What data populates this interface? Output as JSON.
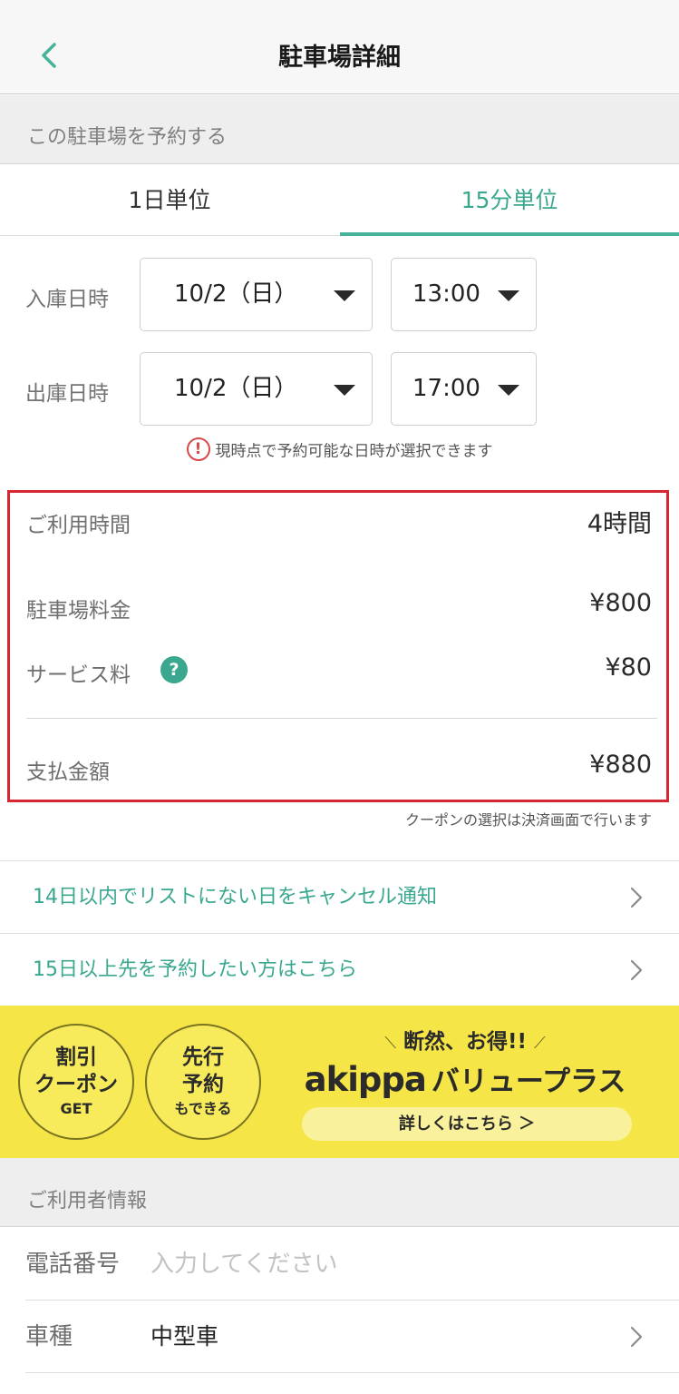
{
  "header": {
    "title": "駐車場詳細",
    "back_icon": "chevron-left-icon"
  },
  "reserve": {
    "section_title": "この駐車場を予約する",
    "tabs": [
      {
        "label": "1日単位"
      },
      {
        "label": "15分単位"
      }
    ],
    "active_tab": "15分単位",
    "entry": {
      "label": "入庫日時",
      "date": "10/2（日）",
      "time": "13:00"
    },
    "exit": {
      "label": "出庫日時",
      "date": "10/2（日）",
      "time": "17:00"
    },
    "notice": {
      "icon_text": "!",
      "text": "現時点で予約可能な日時が選択できます"
    }
  },
  "fees": {
    "usage_time": {
      "label": "ご利用時間",
      "value": "4時間"
    },
    "parking_fee": {
      "label": "駐車場料金",
      "value": "¥800"
    },
    "service_fee": {
      "label": "サービス料",
      "value": "¥80",
      "help_icon_text": "?"
    },
    "total": {
      "label": "支払金額",
      "value": "¥880"
    }
  },
  "coupon_note": "クーポンの選択は決済画面で行います",
  "links": [
    {
      "label": "14日以内でリストにない日をキャンセル通知"
    },
    {
      "label": "15日以上先を予約したい方はこちら"
    }
  ],
  "banner": {
    "circle1": [
      "割引",
      "クーポン",
      "GET"
    ],
    "circle2": [
      "先行",
      "予約",
      "もできる"
    ],
    "deco_left": "⟍",
    "deco_right": "⟋",
    "headline": "断然、お得!!",
    "brand": "akippa",
    "plan": "バリュープラス",
    "cta": "詳しくはこちら ＞"
  },
  "user_info": {
    "section_title": "ご利用者情報",
    "phone": {
      "label": "電話番号",
      "placeholder": "入力してください",
      "value": ""
    },
    "car": {
      "label": "車種",
      "value": "中型車"
    }
  },
  "colors": {
    "accent": "#3aa88f",
    "highlight_border": "#d52631",
    "banner_bg": "#f5e547",
    "warning": "#d74a48"
  }
}
